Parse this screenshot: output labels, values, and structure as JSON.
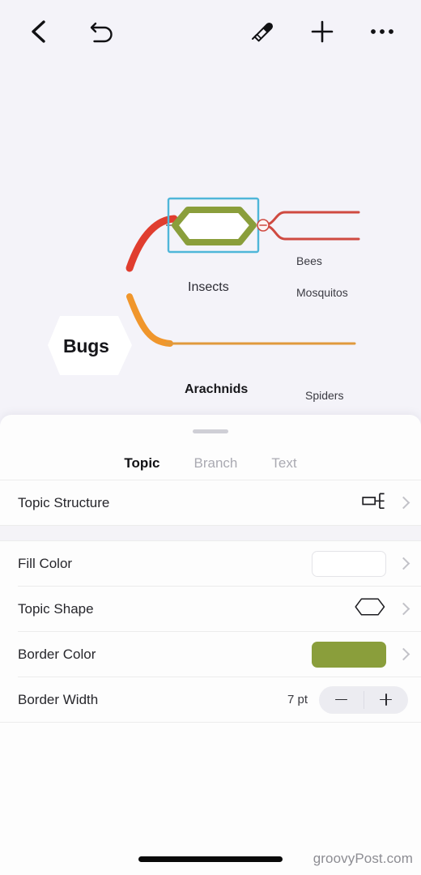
{
  "toolbar": {
    "back_label": "Back",
    "undo_label": "Undo",
    "format_painter_label": "Format Painter",
    "add_label": "Add",
    "more_label": "More"
  },
  "mindmap": {
    "root": {
      "label": "Bugs",
      "shape": "hexagon",
      "fill": "#ffffff"
    },
    "selected_node": {
      "label": "Insects",
      "shape": "hexagon",
      "border_color": "#8a9e3b",
      "selection_color": "#4fb6d9",
      "collapse_button": "minus"
    },
    "branches": [
      {
        "label": "Bees",
        "color": "#d94b41"
      },
      {
        "label": "Mosquitos",
        "color": "#d94b41"
      },
      {
        "label": "Arachnids",
        "color": "#f0962c"
      },
      {
        "label": "Spiders",
        "color": "#e09a3d"
      }
    ]
  },
  "panel": {
    "tabs": [
      {
        "label": "Topic",
        "active": true
      },
      {
        "label": "Branch",
        "active": false
      },
      {
        "label": "Text",
        "active": false
      }
    ],
    "rows": {
      "topic_structure": {
        "label": "Topic Structure",
        "icon": "topic-structure-icon"
      },
      "fill_color": {
        "label": "Fill Color",
        "value_color": "#ffffff"
      },
      "topic_shape": {
        "label": "Topic Shape",
        "icon": "hexagon-icon"
      },
      "border_color": {
        "label": "Border Color",
        "value_color": "#8a9e3b"
      },
      "border_width": {
        "label": "Border Width",
        "value": "7 pt",
        "minus_label": "Decrease",
        "plus_label": "Increase"
      }
    }
  },
  "footer": {
    "watermark": "groovyPost.com"
  }
}
